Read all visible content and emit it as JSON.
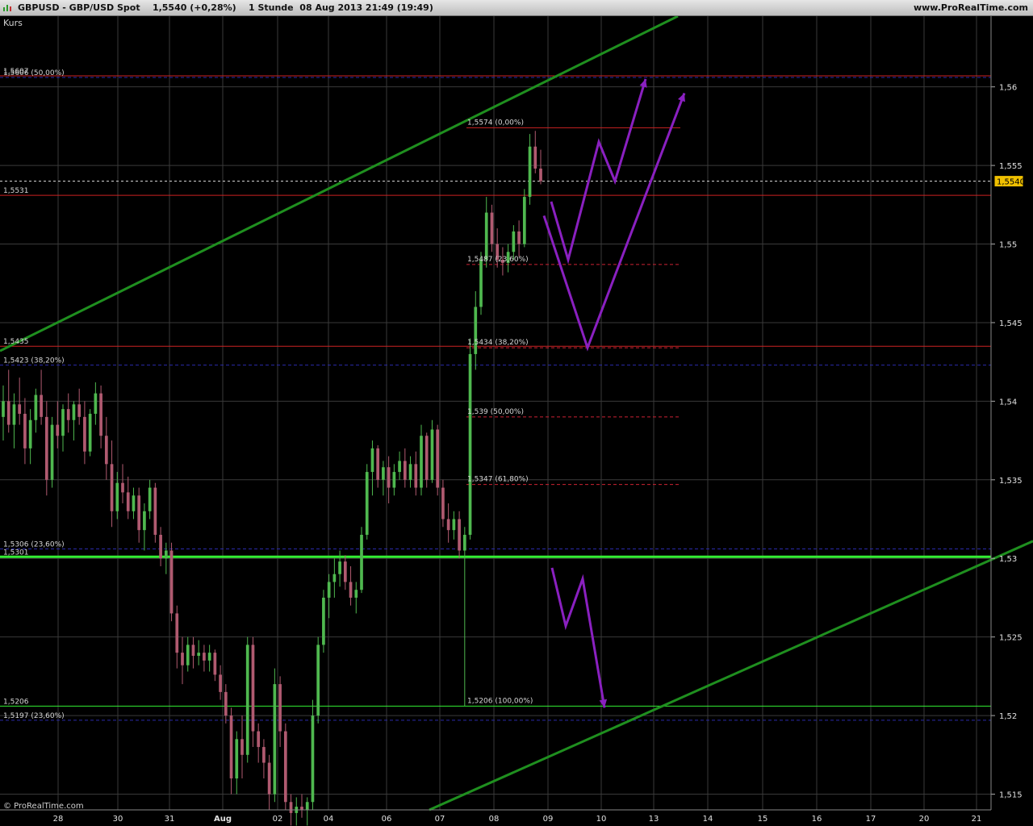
{
  "header": {
    "symbol": "GBPUSD - GBP/USD Spot",
    "price_change": "1,5540 (+0,28%)",
    "timeframe_date": "1 Stunde  08 Aug 2013 21:49 (19:49)",
    "site": "www.ProRealTime.com"
  },
  "footer": {
    "copyright": "© ProRealTime.com"
  },
  "colors": {
    "background": "#000000",
    "grid": "#3a3a3a",
    "up_candle": "#4fb84f",
    "down_candle": "#b05a70",
    "resistance": "#cc2222",
    "fib_dash": "#cc2233",
    "blue_dash": "#2a2aaa",
    "channel": "#1f8f1f",
    "support_bright": "#33ee33",
    "arrows": "#8a20c0",
    "price_tag": "#f0c000"
  },
  "chart_data": {
    "type": "candlestick",
    "title": "Kurs",
    "timeframe": "1 hour",
    "ylim": [
      1.514,
      1.5645
    ],
    "ylabel_ticks": [
      "1,515",
      "1,52",
      "1,525",
      "1,53",
      "1,535",
      "1,54",
      "1,545",
      "1,55",
      "1,555",
      "1,56"
    ],
    "y_tick_values": [
      1.515,
      1.52,
      1.525,
      1.53,
      1.535,
      1.54,
      1.545,
      1.55,
      1.555,
      1.56
    ],
    "x_tick_labels": [
      "28",
      "30",
      "31",
      "Aug",
      "02",
      "04",
      "06",
      "07",
      "08",
      "09",
      "10",
      "13",
      "14",
      "15",
      "16",
      "17",
      "20",
      "21"
    ],
    "last_price": 1.554,
    "last_price_label": "1,5540",
    "horizontal_levels": [
      {
        "value": 1.5607,
        "style": "red",
        "label": "1,5607"
      },
      {
        "value": 1.5531,
        "style": "red",
        "label": "1,5531"
      },
      {
        "value": 1.5435,
        "style": "red",
        "label": "1,5435"
      },
      {
        "value": 1.5301,
        "style": "green-thick",
        "label": "1,5301"
      },
      {
        "value": 1.5206,
        "style": "green-thin",
        "label": "1,5206"
      },
      {
        "value": 1.5606,
        "style": "blue-dash",
        "label": "1,5606 (50,00%)"
      },
      {
        "value": 1.5423,
        "style": "blue-dash",
        "label": "1,5423 (38,20%)"
      },
      {
        "value": 1.5306,
        "style": "blue-dash",
        "label": "1,5306 (23,60%)"
      },
      {
        "value": 1.5197,
        "style": "blue-dash",
        "label": "1,5197 (23,60%)"
      }
    ],
    "fibonacci": [
      {
        "value": 1.5574,
        "label": "1,5574 (0,00%)"
      },
      {
        "value": 1.5487,
        "label": "1,5487 (23,60%)"
      },
      {
        "value": 1.5434,
        "label": "1,5434 (38,20%)"
      },
      {
        "value": 1.539,
        "label": "1,539 (50,00%)"
      },
      {
        "value": 1.5347,
        "label": "1,5347 (61,80%)"
      },
      {
        "value": 1.5206,
        "label": "1,5206 (100,00%)"
      }
    ],
    "candles": [
      {
        "x": "26 Jul",
        "o": 1.539,
        "h": 1.541,
        "l": 1.5375,
        "c": 1.54
      },
      {
        "x": "26 Jul",
        "o": 1.54,
        "h": 1.542,
        "l": 1.538,
        "c": 1.5385
      },
      {
        "x": "26 Jul",
        "o": 1.5385,
        "h": 1.5405,
        "l": 1.537,
        "c": 1.5398
      },
      {
        "x": "26 Jul",
        "o": 1.5398,
        "h": 1.5415,
        "l": 1.5385,
        "c": 1.5392
      },
      {
        "x": "26 Jul",
        "o": 1.5392,
        "h": 1.5402,
        "l": 1.536,
        "c": 1.537
      },
      {
        "x": "26 Jul",
        "o": 1.537,
        "h": 1.5395,
        "l": 1.536,
        "c": 1.5388
      },
      {
        "x": "28 Jul",
        "o": 1.5388,
        "h": 1.5408,
        "l": 1.538,
        "c": 1.5404
      },
      {
        "x": "28 Jul",
        "o": 1.5404,
        "h": 1.542,
        "l": 1.5385,
        "c": 1.539
      },
      {
        "x": "28 Jul",
        "o": 1.539,
        "h": 1.54,
        "l": 1.534,
        "c": 1.535
      },
      {
        "x": "28 Jul",
        "o": 1.535,
        "h": 1.539,
        "l": 1.5345,
        "c": 1.5385
      },
      {
        "x": "28 Jul",
        "o": 1.5385,
        "h": 1.54,
        "l": 1.537,
        "c": 1.5378
      },
      {
        "x": "28 Jul",
        "o": 1.5378,
        "h": 1.5398,
        "l": 1.5368,
        "c": 1.5395
      },
      {
        "x": "29 Jul",
        "o": 1.5395,
        "h": 1.5405,
        "l": 1.538,
        "c": 1.5388
      },
      {
        "x": "29 Jul",
        "o": 1.5388,
        "h": 1.54,
        "l": 1.5375,
        "c": 1.5398
      },
      {
        "x": "29 Jul",
        "o": 1.5398,
        "h": 1.5408,
        "l": 1.5385,
        "c": 1.539
      },
      {
        "x": "29 Jul",
        "o": 1.539,
        "h": 1.54,
        "l": 1.536,
        "c": 1.5368
      },
      {
        "x": "29 Jul",
        "o": 1.5368,
        "h": 1.5395,
        "l": 1.5365,
        "c": 1.5392
      },
      {
        "x": "29 Jul",
        "o": 1.5392,
        "h": 1.5412,
        "l": 1.5385,
        "c": 1.5405
      },
      {
        "x": "29 Jul",
        "o": 1.5405,
        "h": 1.541,
        "l": 1.537,
        "c": 1.5378
      },
      {
        "x": "29 Jul",
        "o": 1.5378,
        "h": 1.539,
        "l": 1.535,
        "c": 1.536
      },
      {
        "x": "29 Jul",
        "o": 1.536,
        "h": 1.5375,
        "l": 1.532,
        "c": 1.533
      },
      {
        "x": "29 Jul",
        "o": 1.533,
        "h": 1.5355,
        "l": 1.5325,
        "c": 1.5348
      },
      {
        "x": "30 Jul",
        "o": 1.5348,
        "h": 1.536,
        "l": 1.5335,
        "c": 1.5342
      },
      {
        "x": "30 Jul",
        "o": 1.5342,
        "h": 1.5352,
        "l": 1.5325,
        "c": 1.533
      },
      {
        "x": "30 Jul",
        "o": 1.533,
        "h": 1.5345,
        "l": 1.5325,
        "c": 1.534
      },
      {
        "x": "30 Jul",
        "o": 1.534,
        "h": 1.5345,
        "l": 1.531,
        "c": 1.5318
      },
      {
        "x": "30 Jul",
        "o": 1.5318,
        "h": 1.5335,
        "l": 1.5305,
        "c": 1.533
      },
      {
        "x": "30 Jul",
        "o": 1.533,
        "h": 1.535,
        "l": 1.5325,
        "c": 1.5345
      },
      {
        "x": "30 Jul",
        "o": 1.5345,
        "h": 1.5348,
        "l": 1.531,
        "c": 1.5315
      },
      {
        "x": "30 Jul",
        "o": 1.5315,
        "h": 1.532,
        "l": 1.5295,
        "c": 1.53
      },
      {
        "x": "30 Jul",
        "o": 1.53,
        "h": 1.531,
        "l": 1.529,
        "c": 1.5305
      },
      {
        "x": "31 Jul",
        "o": 1.5305,
        "h": 1.531,
        "l": 1.526,
        "c": 1.5265
      },
      {
        "x": "31 Jul",
        "o": 1.5265,
        "h": 1.527,
        "l": 1.523,
        "c": 1.524
      },
      {
        "x": "31 Jul",
        "o": 1.524,
        "h": 1.525,
        "l": 1.522,
        "c": 1.5232
      },
      {
        "x": "31 Jul",
        "o": 1.5232,
        "h": 1.525,
        "l": 1.5228,
        "c": 1.5245
      },
      {
        "x": "31 Jul",
        "o": 1.5245,
        "h": 1.525,
        "l": 1.523,
        "c": 1.5238
      },
      {
        "x": "31 Jul",
        "o": 1.5238,
        "h": 1.5248,
        "l": 1.5232,
        "c": 1.524
      },
      {
        "x": "31 Jul",
        "o": 1.524,
        "h": 1.5245,
        "l": 1.5228,
        "c": 1.5235
      },
      {
        "x": "31 Jul",
        "o": 1.5235,
        "h": 1.5245,
        "l": 1.5228,
        "c": 1.524
      },
      {
        "x": "31 Jul",
        "o": 1.524,
        "h": 1.5242,
        "l": 1.5222,
        "c": 1.5226
      },
      {
        "x": "31 Jul",
        "o": 1.5226,
        "h": 1.5232,
        "l": 1.521,
        "c": 1.5215
      },
      {
        "x": "31 Jul",
        "o": 1.5215,
        "h": 1.522,
        "l": 1.5195,
        "c": 1.52
      },
      {
        "x": "31 Jul",
        "o": 1.52,
        "h": 1.5205,
        "l": 1.515,
        "c": 1.516
      },
      {
        "x": "01 Aug",
        "o": 1.516,
        "h": 1.519,
        "l": 1.515,
        "c": 1.5185
      },
      {
        "x": "01 Aug",
        "o": 1.5185,
        "h": 1.52,
        "l": 1.516,
        "c": 1.5175
      },
      {
        "x": "01 Aug",
        "o": 1.5175,
        "h": 1.525,
        "l": 1.517,
        "c": 1.5245
      },
      {
        "x": "01 Aug",
        "o": 1.5245,
        "h": 1.525,
        "l": 1.518,
        "c": 1.519
      },
      {
        "x": "01 Aug",
        "o": 1.519,
        "h": 1.5195,
        "l": 1.517,
        "c": 1.518
      },
      {
        "x": "01 Aug",
        "o": 1.518,
        "h": 1.5185,
        "l": 1.516,
        "c": 1.517
      },
      {
        "x": "01 Aug",
        "o": 1.517,
        "h": 1.5175,
        "l": 1.514,
        "c": 1.515
      },
      {
        "x": "01 Aug",
        "o": 1.515,
        "h": 1.523,
        "l": 1.5145,
        "c": 1.522
      },
      {
        "x": "01 Aug",
        "o": 1.522,
        "h": 1.5225,
        "l": 1.518,
        "c": 1.519
      },
      {
        "x": "01 Aug",
        "o": 1.519,
        "h": 1.5195,
        "l": 1.514,
        "c": 1.5145
      },
      {
        "x": "02 Aug",
        "o": 1.5145,
        "h": 1.515,
        "l": 1.513,
        "c": 1.5138
      },
      {
        "x": "02 Aug",
        "o": 1.5138,
        "h": 1.5148,
        "l": 1.513,
        "c": 1.5142
      },
      {
        "x": "02 Aug",
        "o": 1.5142,
        "h": 1.515,
        "l": 1.5135,
        "c": 1.514
      },
      {
        "x": "02 Aug",
        "o": 1.514,
        "h": 1.5148,
        "l": 1.513,
        "c": 1.5145
      },
      {
        "x": "02 Aug",
        "o": 1.5145,
        "h": 1.521,
        "l": 1.514,
        "c": 1.52
      },
      {
        "x": "02 Aug",
        "o": 1.52,
        "h": 1.525,
        "l": 1.5195,
        "c": 1.5245
      },
      {
        "x": "02 Aug",
        "o": 1.5245,
        "h": 1.528,
        "l": 1.524,
        "c": 1.5275
      },
      {
        "x": "02 Aug",
        "o": 1.5275,
        "h": 1.529,
        "l": 1.5262,
        "c": 1.5285
      },
      {
        "x": "04 Aug",
        "o": 1.5285,
        "h": 1.53,
        "l": 1.5275,
        "c": 1.529
      },
      {
        "x": "04 Aug",
        "o": 1.529,
        "h": 1.5305,
        "l": 1.5282,
        "c": 1.5298
      },
      {
        "x": "04 Aug",
        "o": 1.5298,
        "h": 1.5302,
        "l": 1.528,
        "c": 1.5285
      },
      {
        "x": "04 Aug",
        "o": 1.5285,
        "h": 1.5295,
        "l": 1.527,
        "c": 1.5275
      },
      {
        "x": "04 Aug",
        "o": 1.5275,
        "h": 1.5285,
        "l": 1.5265,
        "c": 1.528
      },
      {
        "x": "05 Aug",
        "o": 1.528,
        "h": 1.532,
        "l": 1.5278,
        "c": 1.5315
      },
      {
        "x": "05 Aug",
        "o": 1.5315,
        "h": 1.536,
        "l": 1.5312,
        "c": 1.5355
      },
      {
        "x": "05 Aug",
        "o": 1.5355,
        "h": 1.5375,
        "l": 1.534,
        "c": 1.537
      },
      {
        "x": "05 Aug",
        "o": 1.537,
        "h": 1.5372,
        "l": 1.5345,
        "c": 1.535
      },
      {
        "x": "05 Aug",
        "o": 1.535,
        "h": 1.5362,
        "l": 1.534,
        "c": 1.5358
      },
      {
        "x": "05 Aug",
        "o": 1.5358,
        "h": 1.5365,
        "l": 1.5335,
        "c": 1.5345
      },
      {
        "x": "06 Aug",
        "o": 1.5345,
        "h": 1.536,
        "l": 1.534,
        "c": 1.5355
      },
      {
        "x": "06 Aug",
        "o": 1.5355,
        "h": 1.5368,
        "l": 1.535,
        "c": 1.5362
      },
      {
        "x": "06 Aug",
        "o": 1.5362,
        "h": 1.537,
        "l": 1.5345,
        "c": 1.535
      },
      {
        "x": "06 Aug",
        "o": 1.535,
        "h": 1.5365,
        "l": 1.5345,
        "c": 1.536
      },
      {
        "x": "06 Aug",
        "o": 1.536,
        "h": 1.5368,
        "l": 1.534,
        "c": 1.5345
      },
      {
        "x": "06 Aug",
        "o": 1.5345,
        "h": 1.5385,
        "l": 1.534,
        "c": 1.5378
      },
      {
        "x": "06 Aug",
        "o": 1.5378,
        "h": 1.538,
        "l": 1.5345,
        "c": 1.535
      },
      {
        "x": "06 Aug",
        "o": 1.535,
        "h": 1.5388,
        "l": 1.5348,
        "c": 1.5382
      },
      {
        "x": "06 Aug",
        "o": 1.5382,
        "h": 1.5385,
        "l": 1.534,
        "c": 1.5345
      },
      {
        "x": "07 Aug",
        "o": 1.5345,
        "h": 1.535,
        "l": 1.532,
        "c": 1.5325
      },
      {
        "x": "07 Aug",
        "o": 1.5325,
        "h": 1.5335,
        "l": 1.531,
        "c": 1.5318
      },
      {
        "x": "07 Aug",
        "o": 1.5318,
        "h": 1.533,
        "l": 1.5312,
        "c": 1.5325
      },
      {
        "x": "07 Aug",
        "o": 1.5325,
        "h": 1.533,
        "l": 1.53,
        "c": 1.5305
      },
      {
        "x": "07 Aug",
        "o": 1.5305,
        "h": 1.532,
        "l": 1.5206,
        "c": 1.5315
      },
      {
        "x": "07 Aug",
        "o": 1.5315,
        "h": 1.544,
        "l": 1.5312,
        "c": 1.543
      },
      {
        "x": "07 Aug",
        "o": 1.543,
        "h": 1.547,
        "l": 1.542,
        "c": 1.546
      },
      {
        "x": "07 Aug",
        "o": 1.546,
        "h": 1.5495,
        "l": 1.5455,
        "c": 1.549
      },
      {
        "x": "08 Aug",
        "o": 1.549,
        "h": 1.553,
        "l": 1.5485,
        "c": 1.552
      },
      {
        "x": "08 Aug",
        "o": 1.552,
        "h": 1.5525,
        "l": 1.5495,
        "c": 1.55
      },
      {
        "x": "08 Aug",
        "o": 1.55,
        "h": 1.551,
        "l": 1.5485,
        "c": 1.549
      },
      {
        "x": "08 Aug",
        "o": 1.549,
        "h": 1.5498,
        "l": 1.548,
        "c": 1.5488
      },
      {
        "x": "08 Aug",
        "o": 1.5488,
        "h": 1.55,
        "l": 1.5482,
        "c": 1.5495
      },
      {
        "x": "08 Aug",
        "o": 1.5495,
        "h": 1.5512,
        "l": 1.549,
        "c": 1.5508
      },
      {
        "x": "08 Aug",
        "o": 1.5508,
        "h": 1.5515,
        "l": 1.5492,
        "c": 1.55
      },
      {
        "x": "08 Aug",
        "o": 1.55,
        "h": 1.5535,
        "l": 1.5498,
        "c": 1.553
      },
      {
        "x": "08 Aug",
        "o": 1.553,
        "h": 1.557,
        "l": 1.5525,
        "c": 1.5562
      },
      {
        "x": "08 Aug",
        "o": 1.5562,
        "h": 1.5572,
        "l": 1.5545,
        "c": 1.5548
      },
      {
        "x": "08 Aug",
        "o": 1.5548,
        "h": 1.556,
        "l": 1.5538,
        "c": 1.554
      }
    ],
    "trendlines": [
      {
        "name": "channel-upper",
        "points": [
          [
            "25 Jul",
            1.5435
          ],
          [
            "09 Aug",
            1.564
          ]
        ]
      },
      {
        "name": "channel-lower",
        "points": [
          [
            "07 Aug",
            1.514
          ],
          [
            "21 Aug",
            1.531
          ]
        ]
      }
    ],
    "annotations": [
      {
        "name": "arrow-zigzag-up-small",
        "points": [
          [
            1.5527,
            "08 Aug 22:00"
          ],
          [
            1.549,
            "09 Aug"
          ],
          [
            1.5565,
            "10 Aug"
          ],
          [
            1.554,
            "10 Aug"
          ],
          [
            1.5605,
            "13 Aug"
          ]
        ]
      },
      {
        "name": "arrow-zigzag-up-large",
        "points": [
          [
            1.5518,
            "08 Aug 20:00"
          ],
          [
            1.5434,
            "09 Aug"
          ],
          [
            1.5596,
            "13 Aug"
          ]
        ]
      },
      {
        "name": "arrow-zigzag-down",
        "points": [
          [
            1.5294,
            "08 Aug 22:00"
          ],
          [
            1.5257,
            "09 Aug"
          ],
          [
            1.5287,
            "10 Aug"
          ],
          [
            1.5205,
            "10 Aug"
          ]
        ]
      }
    ]
  }
}
